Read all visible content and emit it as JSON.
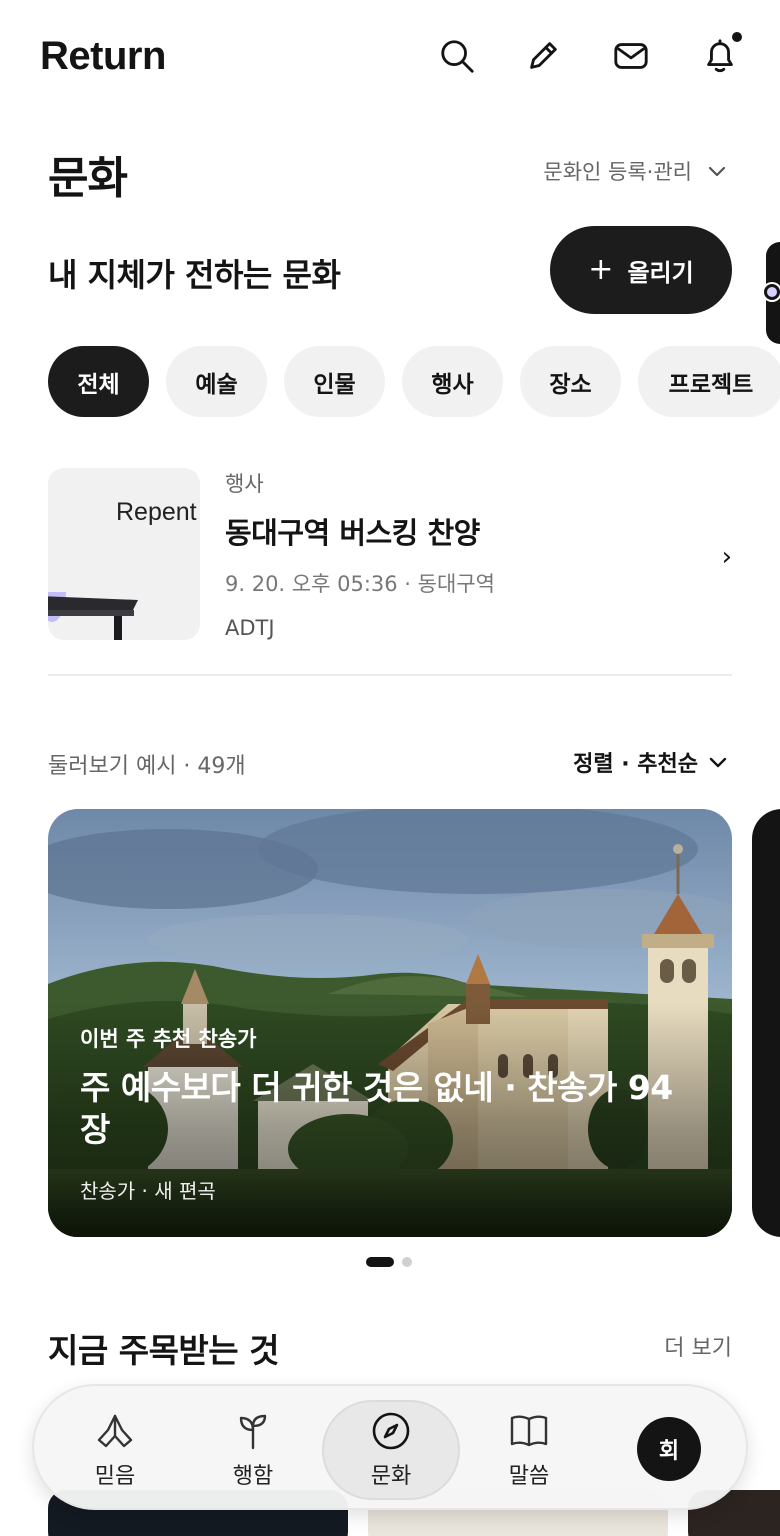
{
  "app": {
    "logo": "Return",
    "top_icons": [
      "search-icon",
      "pencil-icon",
      "mail-icon",
      "bell-icon"
    ]
  },
  "section": {
    "title": "문화",
    "manage_label": "문화인 등록·관리",
    "subtitle": "내 지체가 전하는 문화",
    "upload_label": "올리기"
  },
  "chips": [
    {
      "label": "전체",
      "active": true
    },
    {
      "label": "예술",
      "active": false
    },
    {
      "label": "인물",
      "active": false
    },
    {
      "label": "행사",
      "active": false
    },
    {
      "label": "장소",
      "active": false
    },
    {
      "label": "프로젝트",
      "active": false
    }
  ],
  "event": {
    "thumb_text": "Repent",
    "category": "행사",
    "title": "동대구역 버스킹 찬양",
    "meta": "9. 20. 오후 05:36 · 동대구역",
    "org": "ADTJ",
    "chevron": "›"
  },
  "browse": {
    "label": "둘러보기 예시 · 49개",
    "sort_label": "정렬 · 추천순"
  },
  "hero": {
    "tag": "이번 주 추천 찬송가",
    "title": "주 예수보다 더 귀한 것은 없네 · 찬송가 94장",
    "subtitle": "찬송가 · 새 편곡",
    "page_count": 2,
    "active_page": 1
  },
  "trending": {
    "title": "지금 주목받는 것",
    "more_label": "더 보기"
  },
  "bottom_nav": {
    "items": [
      {
        "label": "믿음",
        "icon": "praying-hands-icon",
        "active": false
      },
      {
        "label": "행함",
        "icon": "sprout-icon",
        "active": false
      },
      {
        "label": "문화",
        "icon": "compass-icon",
        "active": true
      },
      {
        "label": "말씀",
        "icon": "book-icon",
        "active": false
      }
    ],
    "avatar_label": "회"
  },
  "colors": {
    "primary": "#1c1c1c",
    "chip_bg": "#f1f1f1",
    "muted_text": "#666666"
  }
}
